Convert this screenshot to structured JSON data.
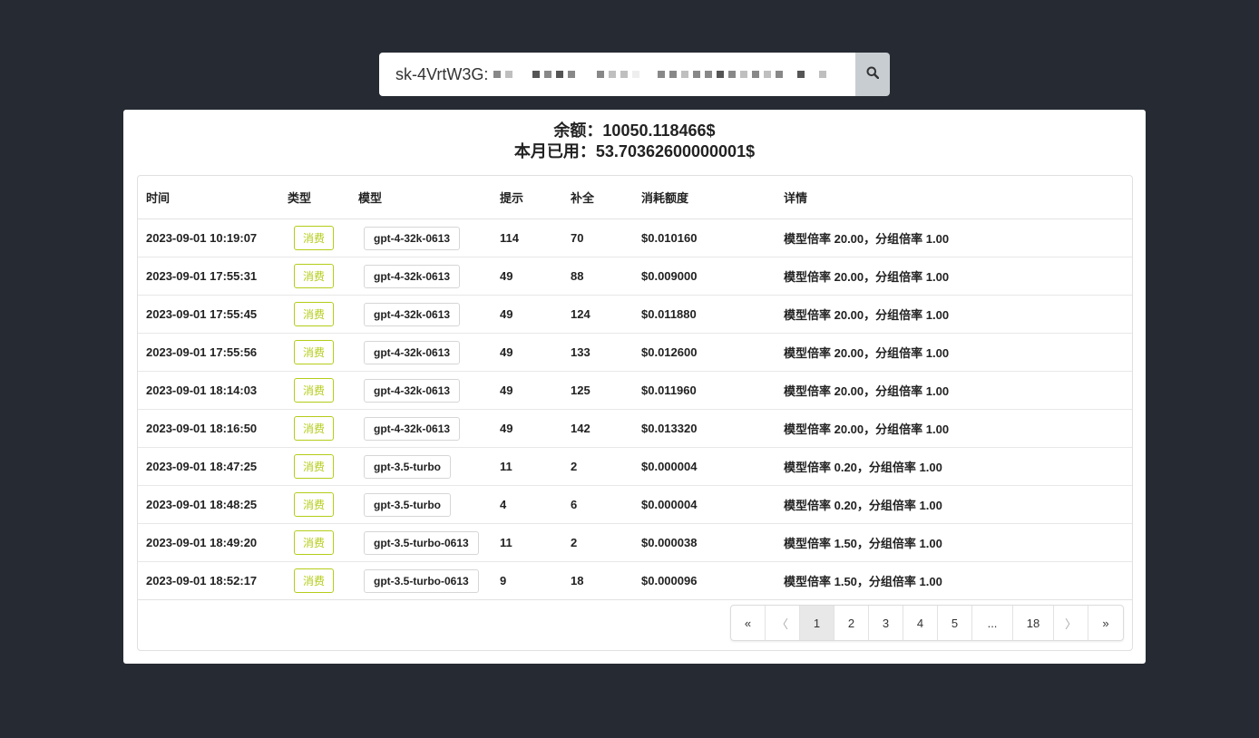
{
  "search": {
    "value": "sk-4VrtW3G:"
  },
  "summary": {
    "balance": "余额：10050.118466$",
    "monthly_used": "本月已用：53.70362600000001$"
  },
  "table": {
    "headers": [
      "时间",
      "类型",
      "模型",
      "提示",
      "补全",
      "消耗额度",
      "详情"
    ],
    "rows": [
      {
        "time": "2023-09-01 10:19:07",
        "type": "消费",
        "model": "gpt-4-32k-0613",
        "prompt": "114",
        "completion": "70",
        "cost": "$0.010160",
        "detail": "模型倍率 20.00，分组倍率 1.00"
      },
      {
        "time": "2023-09-01 17:55:31",
        "type": "消费",
        "model": "gpt-4-32k-0613",
        "prompt": "49",
        "completion": "88",
        "cost": "$0.009000",
        "detail": "模型倍率 20.00，分组倍率 1.00"
      },
      {
        "time": "2023-09-01 17:55:45",
        "type": "消费",
        "model": "gpt-4-32k-0613",
        "prompt": "49",
        "completion": "124",
        "cost": "$0.011880",
        "detail": "模型倍率 20.00，分组倍率 1.00"
      },
      {
        "time": "2023-09-01 17:55:56",
        "type": "消费",
        "model": "gpt-4-32k-0613",
        "prompt": "49",
        "completion": "133",
        "cost": "$0.012600",
        "detail": "模型倍率 20.00，分组倍率 1.00"
      },
      {
        "time": "2023-09-01 18:14:03",
        "type": "消费",
        "model": "gpt-4-32k-0613",
        "prompt": "49",
        "completion": "125",
        "cost": "$0.011960",
        "detail": "模型倍率 20.00，分组倍率 1.00"
      },
      {
        "time": "2023-09-01 18:16:50",
        "type": "消费",
        "model": "gpt-4-32k-0613",
        "prompt": "49",
        "completion": "142",
        "cost": "$0.013320",
        "detail": "模型倍率 20.00，分组倍率 1.00"
      },
      {
        "time": "2023-09-01 18:47:25",
        "type": "消费",
        "model": "gpt-3.5-turbo",
        "prompt": "11",
        "completion": "2",
        "cost": "$0.000004",
        "detail": "模型倍率 0.20，分组倍率 1.00"
      },
      {
        "time": "2023-09-01 18:48:25",
        "type": "消费",
        "model": "gpt-3.5-turbo",
        "prompt": "4",
        "completion": "6",
        "cost": "$0.000004",
        "detail": "模型倍率 0.20，分组倍率 1.00"
      },
      {
        "time": "2023-09-01 18:49:20",
        "type": "消费",
        "model": "gpt-3.5-turbo-0613",
        "prompt": "11",
        "completion": "2",
        "cost": "$0.000038",
        "detail": "模型倍率 1.50，分组倍率 1.00"
      },
      {
        "time": "2023-09-01 18:52:17",
        "type": "消费",
        "model": "gpt-3.5-turbo-0613",
        "prompt": "9",
        "completion": "18",
        "cost": "$0.000096",
        "detail": "模型倍率 1.50，分组倍率 1.00"
      }
    ]
  },
  "pagination": {
    "first": "«",
    "prev": "〈",
    "pages": [
      "1",
      "2",
      "3",
      "4",
      "5",
      "...",
      "18"
    ],
    "next": "〉",
    "last": "»",
    "active_page": "1"
  },
  "colors": {
    "background": "#262b33",
    "type_tag": "#b5cc18"
  },
  "icons": {
    "search": "search-icon"
  }
}
